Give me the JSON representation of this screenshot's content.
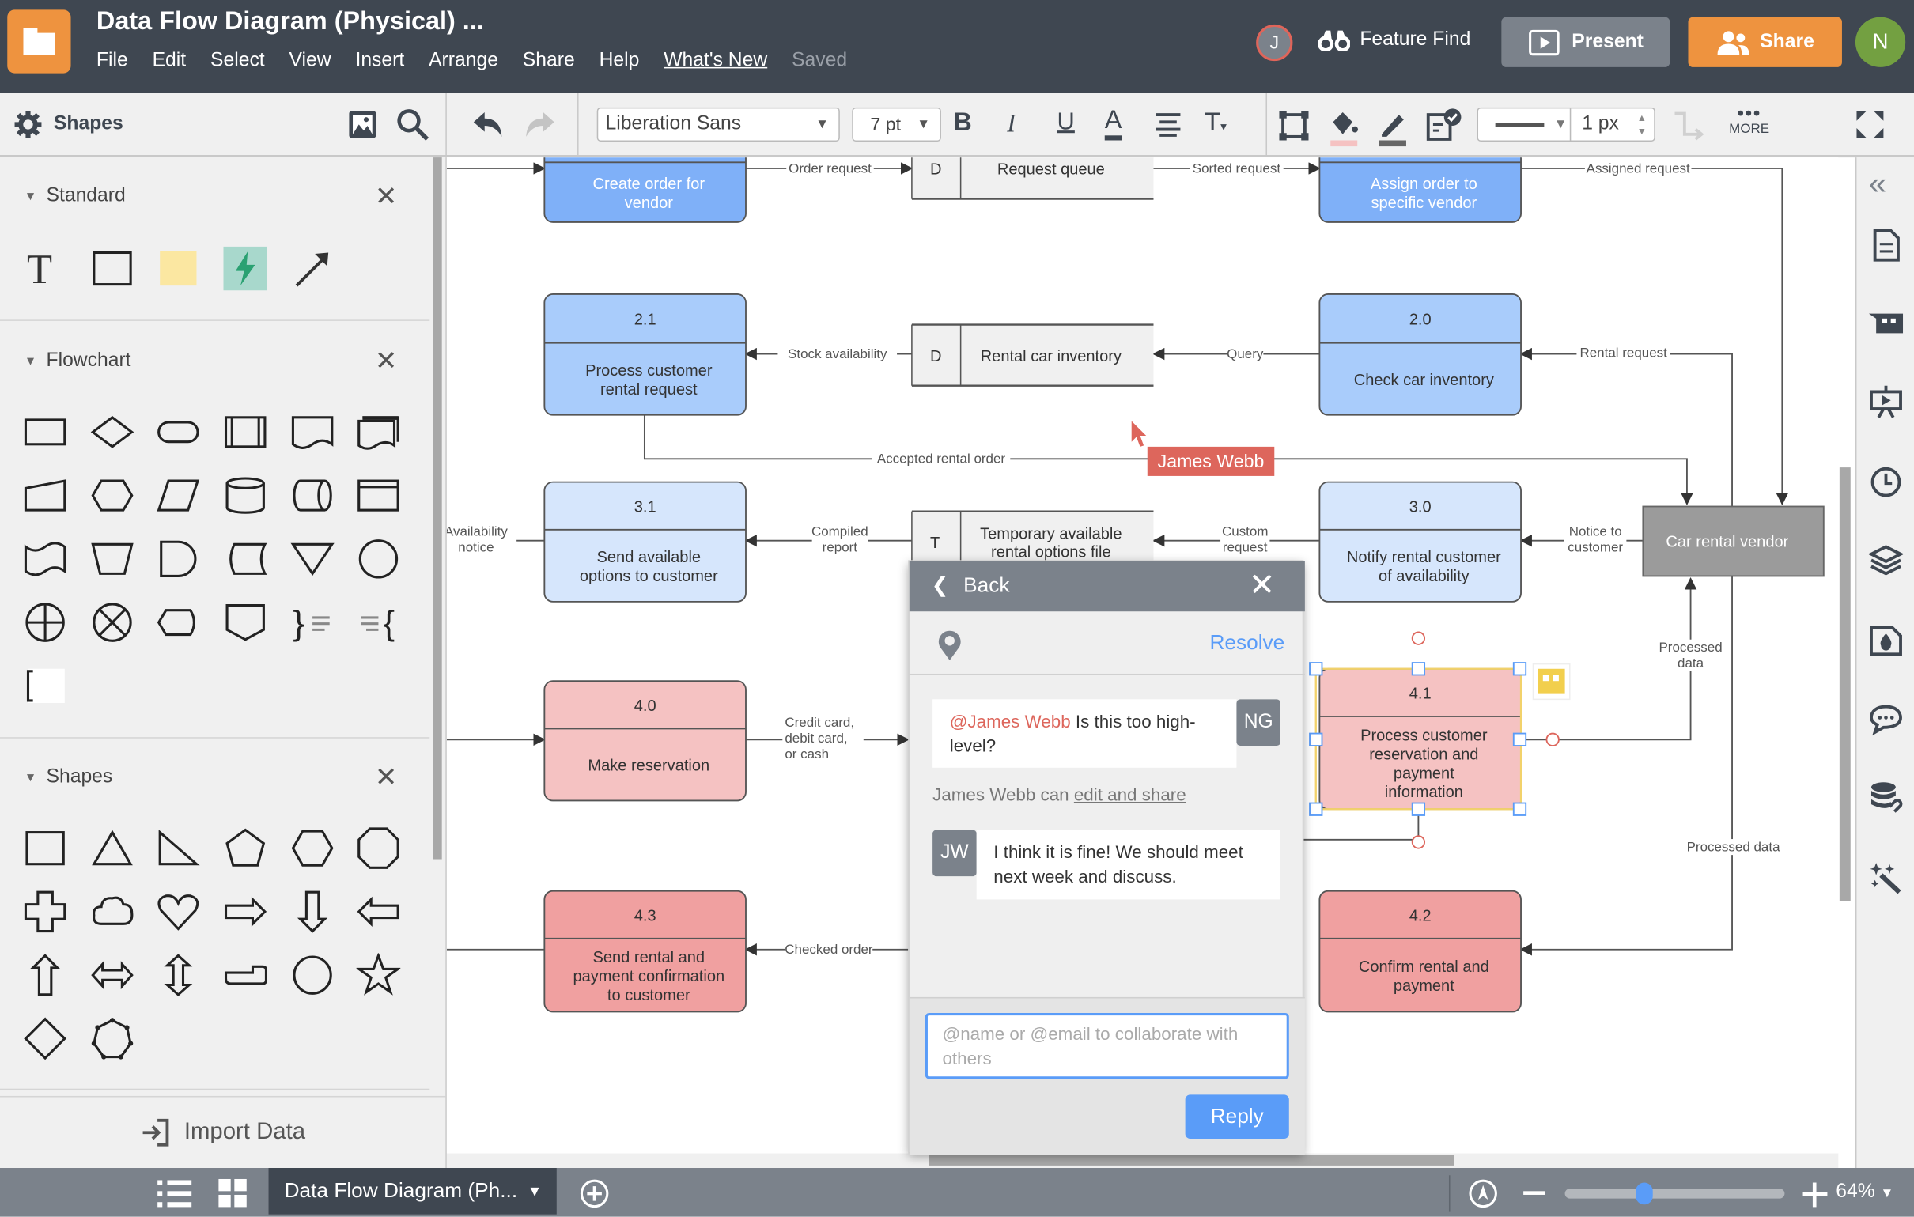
{
  "header": {
    "title": "Data Flow Diagram (Physical) ...",
    "menu": [
      "File",
      "Edit",
      "Select",
      "View",
      "Insert",
      "Arrange",
      "Share",
      "Help",
      "What's New",
      "Saved"
    ],
    "collaborator_initial": "J",
    "feature_find": "Feature Find",
    "present": "Present",
    "share": "Share",
    "user_initial": "N",
    "colors": {
      "brand": "#ee933f",
      "bar": "#3f4751",
      "user": "#73a041"
    }
  },
  "toolbar": {
    "shapes_label": "Shapes",
    "font": "Liberation Sans",
    "font_size": "7 pt",
    "line_width": "1 px",
    "more": "MORE",
    "fill_color": "#f5c2c2",
    "line_color": "#666666"
  },
  "left_panel": {
    "sections": [
      {
        "title": "Standard",
        "shapes": [
          "text",
          "rectangle",
          "sticky-note",
          "lightning",
          "arrow-line"
        ]
      },
      {
        "title": "Flowchart",
        "shapes": [
          "process",
          "decision",
          "terminator",
          "predefined-process",
          "document",
          "multi-document",
          "manual-input",
          "preparation",
          "data",
          "database",
          "direct-access",
          "internal-storage",
          "punched-tape",
          "manual-operation",
          "delay",
          "stored-data",
          "merge",
          "connector",
          "summing-junction",
          "or",
          "display",
          "off-page",
          "annotation-right",
          "annotation-left",
          "bracket"
        ]
      },
      {
        "title": "Shapes",
        "shapes": [
          "rectangle",
          "triangle",
          "right-triangle",
          "pentagon",
          "hexagon",
          "octagon",
          "cross",
          "cloud",
          "heart",
          "arrow-right",
          "arrow-down",
          "arrow-left",
          "arrow-up",
          "arrow-left-right",
          "arrow-up-down",
          "callout-arrow",
          "circle",
          "star",
          "diamond",
          "heptagon"
        ]
      }
    ],
    "import_label": "Import Data"
  },
  "diagram": {
    "nodes": [
      {
        "id": "create",
        "number": "",
        "label": [
          "Create order for",
          "vendor"
        ],
        "fill": "#7fb0f8",
        "text": "#ffffff"
      },
      {
        "id": "assign",
        "number": "",
        "label": [
          "Assign order to",
          "specific vendor"
        ],
        "fill": "#7fb0f8",
        "text": "#ffffff"
      },
      {
        "id": "p21",
        "number": "2.1",
        "label": [
          "Process customer",
          "rental request"
        ],
        "fill": "#a9ccfb",
        "text": "#333333"
      },
      {
        "id": "p20",
        "number": "2.0",
        "label": [
          "Check car inventory"
        ],
        "fill": "#a9ccfb",
        "text": "#333333"
      },
      {
        "id": "p31",
        "number": "3.1",
        "label": [
          "Send available",
          "options to customer"
        ],
        "fill": "#d6e6fc",
        "text": "#333333"
      },
      {
        "id": "p30",
        "number": "3.0",
        "label": [
          "Notify rental customer",
          "of availability"
        ],
        "fill": "#d6e6fc",
        "text": "#333333"
      },
      {
        "id": "p40",
        "number": "4.0",
        "label": [
          "Make reservation"
        ],
        "fill": "#f5c2c2",
        "text": "#333333"
      },
      {
        "id": "p41",
        "number": "4.1",
        "label": [
          "Process customer",
          "reservation and",
          "payment",
          "information"
        ],
        "fill": "#f5c2c2",
        "text": "#333333"
      },
      {
        "id": "p43",
        "number": "4.3",
        "label": [
          "Send rental and",
          "payment confirmation",
          "to customer"
        ],
        "fill": "#f0a0a0",
        "text": "#333333"
      },
      {
        "id": "p42",
        "number": "4.2",
        "label": [
          "Confirm rental and",
          "payment"
        ],
        "fill": "#f0a0a0",
        "text": "#333333"
      }
    ],
    "stores": [
      {
        "id": "s1",
        "code": "D",
        "label": [
          "Request queue"
        ]
      },
      {
        "id": "s2",
        "code": "D",
        "label": [
          "Rental car inventory"
        ]
      },
      {
        "id": "s3",
        "code": "T",
        "label": [
          "Temporary available",
          "rental options file"
        ]
      }
    ],
    "entity": {
      "label": "Car rental vendor",
      "fill": "#9b9b9b"
    },
    "flows": [
      {
        "id": "f1",
        "label": []
      },
      {
        "id": "f2",
        "label": [
          "Order request"
        ]
      },
      {
        "id": "f3",
        "label": [
          "Sorted request"
        ]
      },
      {
        "id": "f4",
        "label": [
          "Assigned request"
        ]
      },
      {
        "id": "f5",
        "label": [
          "Query"
        ]
      },
      {
        "id": "f6",
        "label": [
          "Stock availability"
        ]
      },
      {
        "id": "f7",
        "label": [
          "Rental request"
        ]
      },
      {
        "id": "f8",
        "label": [
          "Accepted rental order"
        ]
      },
      {
        "id": "f9",
        "label": [
          "Custom",
          "request"
        ]
      },
      {
        "id": "f10",
        "label": [
          "Compiled",
          "report"
        ]
      },
      {
        "id": "f11",
        "label": [
          "Availability",
          "notice"
        ]
      },
      {
        "id": "f12",
        "label": [
          "Notice to",
          "customer"
        ]
      },
      {
        "id": "f13",
        "label": []
      },
      {
        "id": "f14",
        "label": [
          "Credit card,",
          "debit card,",
          "or cash"
        ]
      },
      {
        "id": "f15",
        "label": [
          "Processed",
          "data"
        ]
      },
      {
        "id": "f16",
        "label": [
          "Processed data"
        ]
      },
      {
        "id": "f17",
        "label": [
          "Checked order"
        ]
      },
      {
        "id": "f18",
        "label": []
      },
      {
        "id": "f19",
        "label": []
      }
    ],
    "cursor_user": "James Webb",
    "cursor_color": "#dd665c"
  },
  "comment_panel": {
    "back": "Back",
    "resolve": "Resolve",
    "comments": [
      {
        "initials": "NG",
        "mention": "@James Webb",
        "text": " Is this too high-level?"
      },
      {
        "initials": "JW",
        "text": "I think it is fine! We should meet next week and discuss."
      }
    ],
    "permission_prefix": "James Webb can ",
    "permission_link": "edit and share",
    "input_placeholder": "@name or @email to collaborate with others",
    "reply": "Reply"
  },
  "bottom_bar": {
    "page_tab": "Data Flow Diagram (Ph...",
    "zoom": "64%",
    "zoom_slider_fraction": 0.36
  }
}
